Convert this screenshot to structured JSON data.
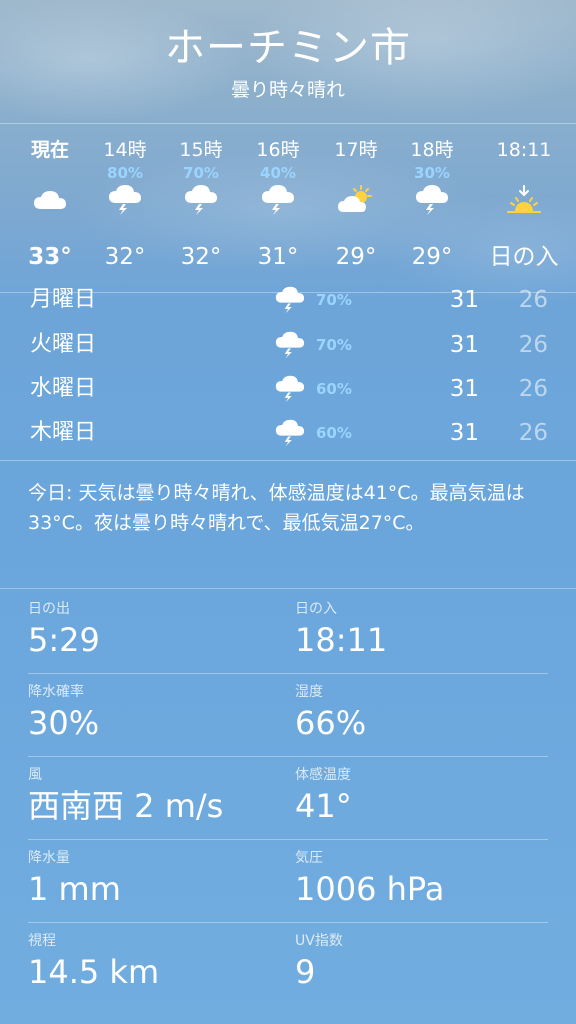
{
  "header": {
    "city": "ホーチミン市",
    "condition": "曇り時々晴れ"
  },
  "hourly": [
    {
      "time": "現在",
      "pop": "",
      "icon": "cloud-icon",
      "temp": "33°",
      "bold": true
    },
    {
      "time": "14時",
      "pop": "80%",
      "icon": "thunderstorm-icon",
      "temp": "32°",
      "bold": false
    },
    {
      "time": "15時",
      "pop": "70%",
      "icon": "thunderstorm-icon",
      "temp": "32°",
      "bold": false
    },
    {
      "time": "16時",
      "pop": "40%",
      "icon": "thunderstorm-icon",
      "temp": "31°",
      "bold": false
    },
    {
      "time": "17時",
      "pop": "",
      "icon": "partly-sunny-icon",
      "temp": "29°",
      "bold": false
    },
    {
      "time": "18時",
      "pop": "30%",
      "icon": "thunderstorm-icon",
      "temp": "29°",
      "bold": false
    },
    {
      "time": "18:11",
      "pop": "",
      "icon": "sunset-icon",
      "temp": "日の入",
      "bold": false
    }
  ],
  "daily": [
    {
      "day": "月曜日",
      "icon": "thunderstorm-icon",
      "pop": "70%",
      "high": "31",
      "low": "26"
    },
    {
      "day": "火曜日",
      "icon": "thunderstorm-icon",
      "pop": "70%",
      "high": "31",
      "low": "26"
    },
    {
      "day": "水曜日",
      "icon": "thunderstorm-icon",
      "pop": "60%",
      "high": "31",
      "low": "26"
    },
    {
      "day": "木曜日",
      "icon": "thunderstorm-icon",
      "pop": "60%",
      "high": "31",
      "low": "26"
    }
  ],
  "summary": "今日: 天気は曇り時々晴れ、体感温度は41°C。最高気温は33°C。夜は曇り時々晴れで、最低気温27°C。",
  "details": [
    {
      "left": {
        "label": "日の出",
        "value": "5:29"
      },
      "right": {
        "label": "日の入",
        "value": "18:11"
      }
    },
    {
      "left": {
        "label": "降水確率",
        "value": "30%"
      },
      "right": {
        "label": "湿度",
        "value": "66%"
      }
    },
    {
      "left": {
        "label": "風",
        "value": "西南西 2 m/s"
      },
      "right": {
        "label": "体感温度",
        "value": "41°"
      }
    },
    {
      "left": {
        "label": "降水量",
        "value": "1 mm"
      },
      "right": {
        "label": "気圧",
        "value": "1006 hPa"
      }
    },
    {
      "left": {
        "label": "視程",
        "value": "14.5 km"
      },
      "right": {
        "label": "UV指数",
        "value": "9"
      }
    }
  ],
  "colors": {
    "precip_accent": "#9ad4ff",
    "sun_yellow": "#ffd23f"
  }
}
